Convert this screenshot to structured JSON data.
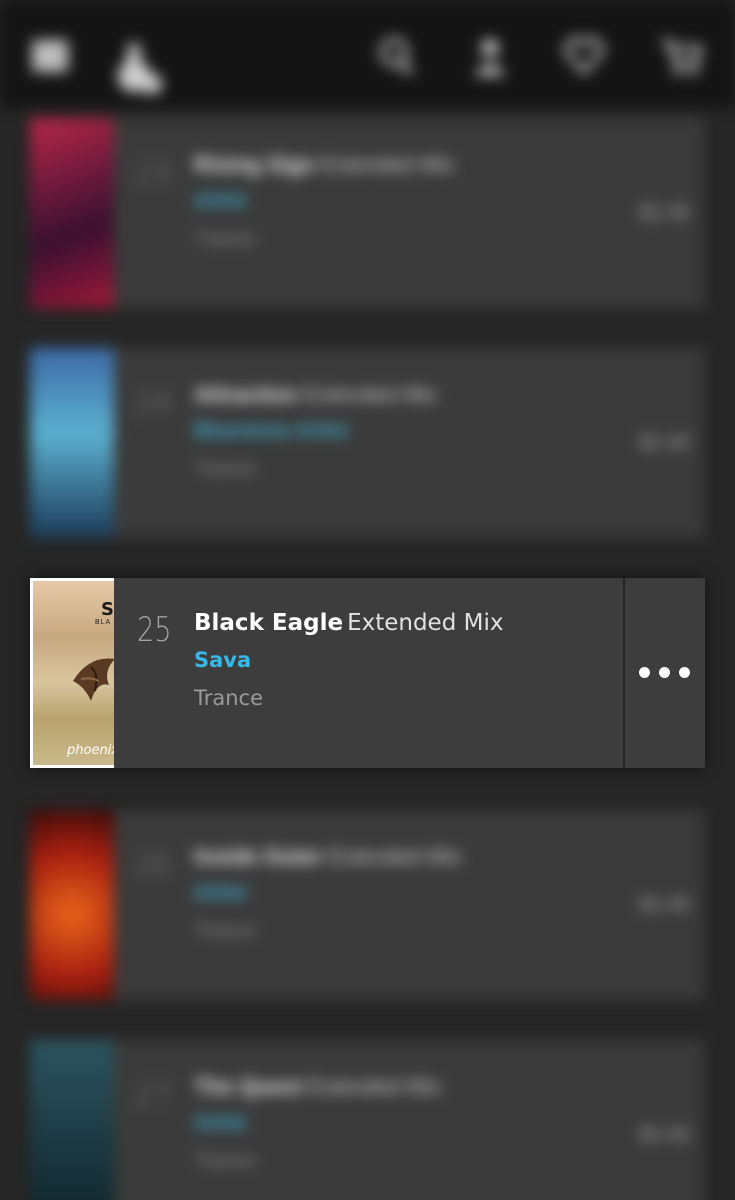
{
  "topbar": {
    "icons": [
      "menu-icon",
      "app-logo-icon",
      "search-icon",
      "account-icon",
      "favorites-icon",
      "cart-icon"
    ]
  },
  "blurred_tracks": [
    {
      "number": "23",
      "title": "Rising Sign",
      "mix": "Extended Mix",
      "artist": "Artist",
      "genre": "Trance",
      "price": "$2.49",
      "art_color": "#7a1e3a"
    },
    {
      "number": "24",
      "title": "Attraction",
      "mix": "Extended Mix",
      "artist": "Bluestone Artist",
      "genre": "Trance",
      "price": "$2.49",
      "art_color": "#2a6f9a"
    },
    {
      "number": "26",
      "title": "Inside Outer",
      "mix": "Extended Mix",
      "artist": "Artist",
      "genre": "Trance",
      "price": "$2.49",
      "art_color": "#b8340f"
    },
    {
      "number": "27",
      "title": "The Quest",
      "mix": "Extended Mix",
      "artist": "Artist",
      "genre": "Trance",
      "price": "$2.49",
      "art_color": "#1e4a57"
    }
  ],
  "focused_track": {
    "number": "25",
    "title": "Black Eagle",
    "mix": "Extended Mix",
    "artist": "Sava",
    "genre": "Trance",
    "cover_letter": "S",
    "cover_sub": "BLA",
    "cover_brand": "phoenix"
  },
  "colors": {
    "accent": "#37b8e6",
    "background": "#262626",
    "row": "#3d3d3d",
    "topbar": "#141414"
  }
}
